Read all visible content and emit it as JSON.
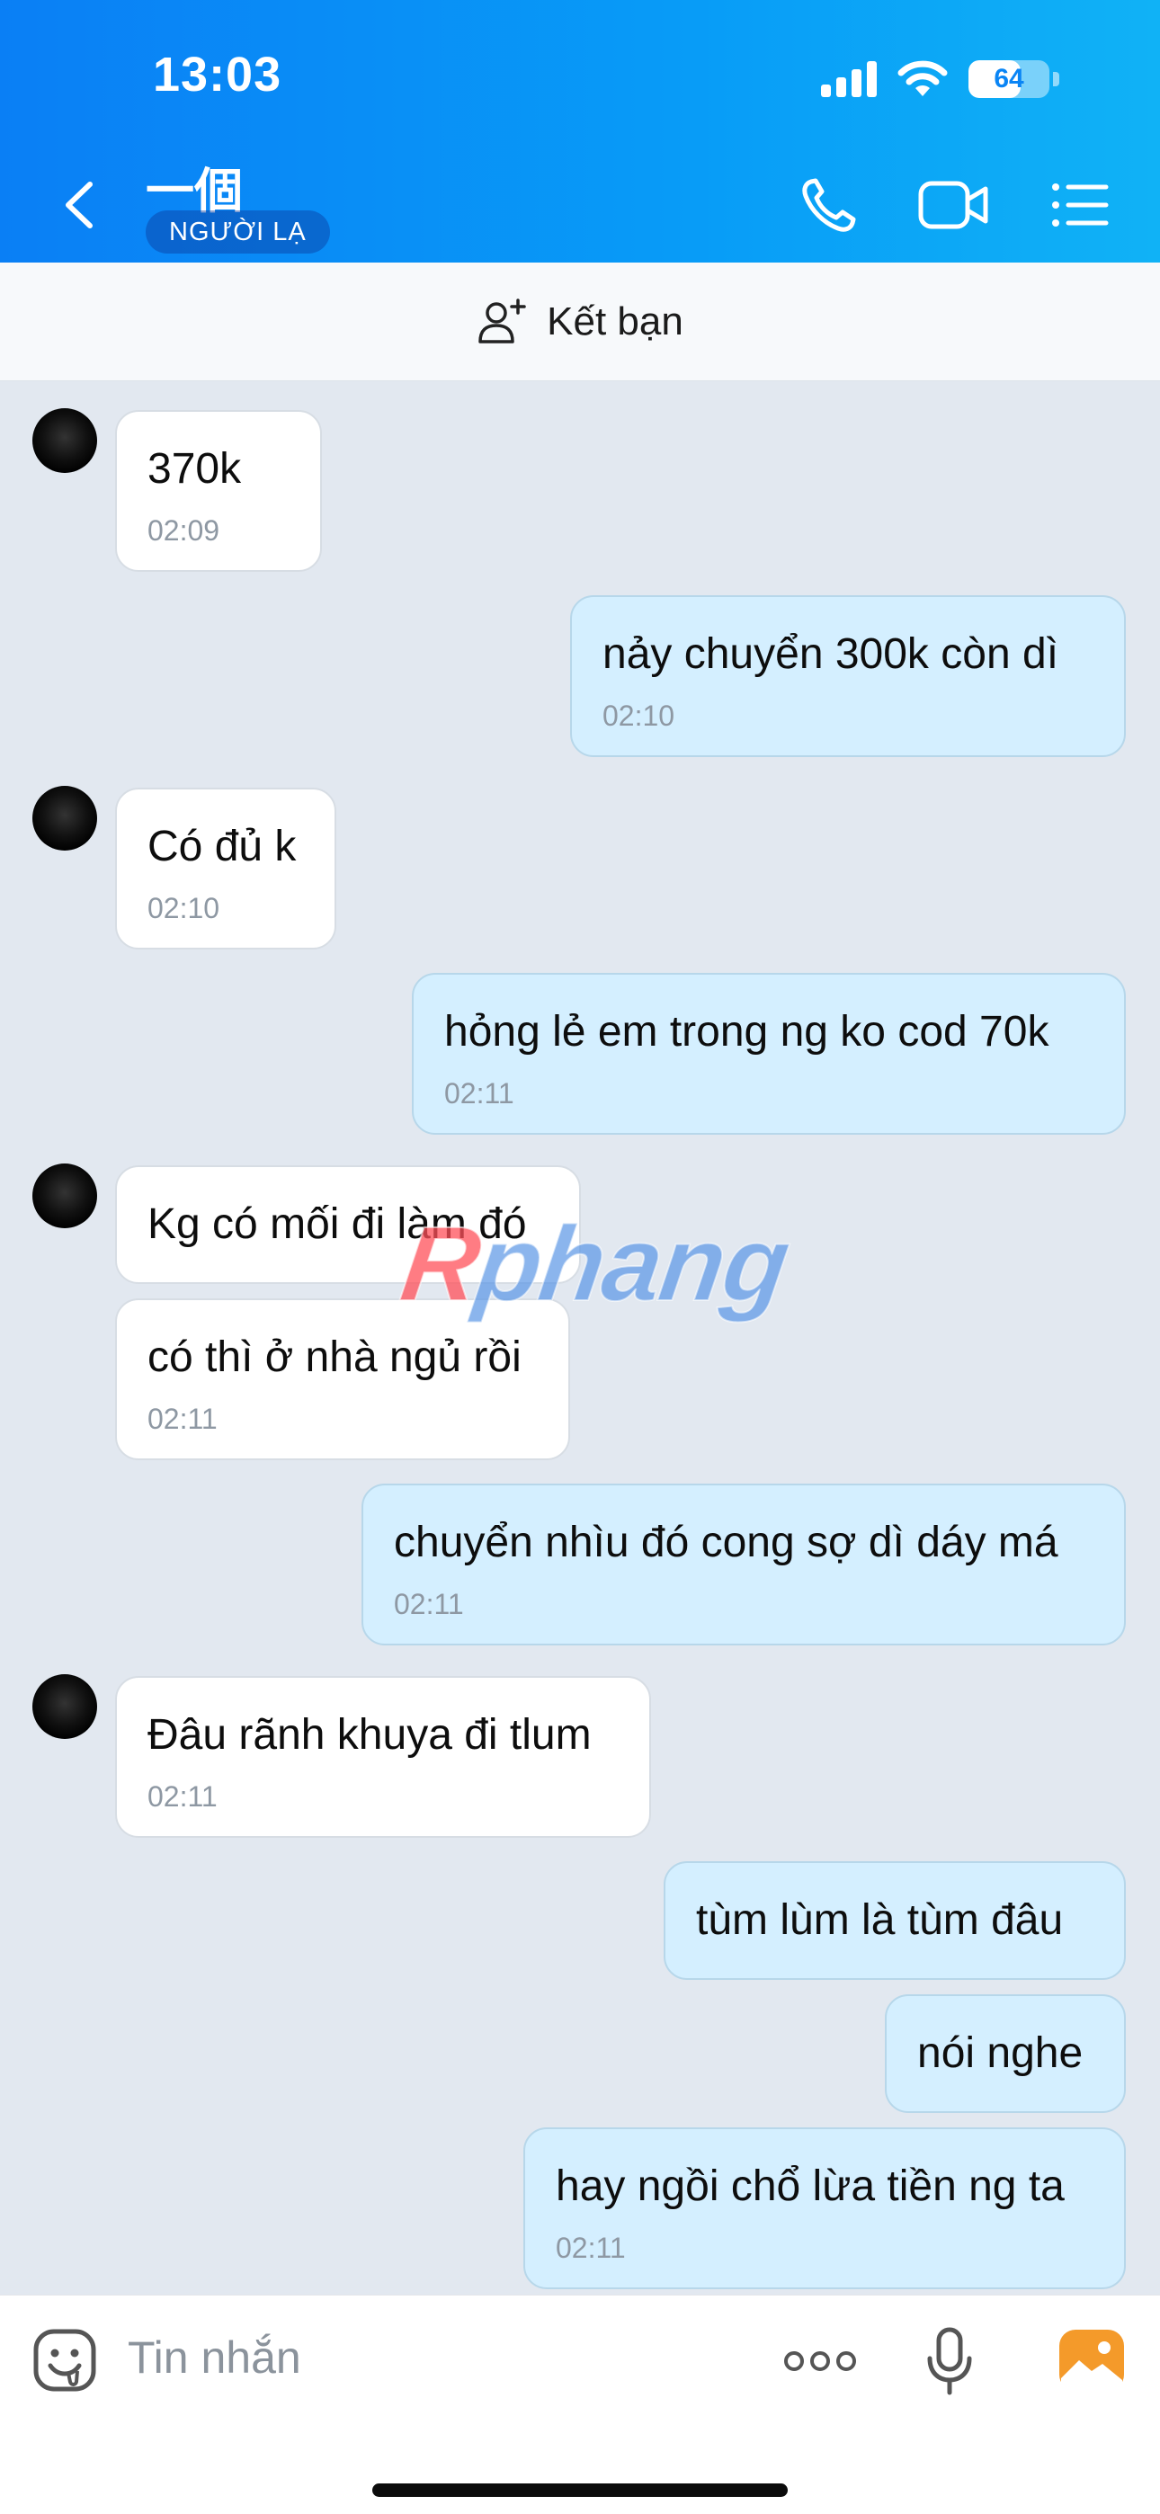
{
  "status_bar": {
    "time": "13:03",
    "battery": "64",
    "battery_level": 0.64
  },
  "header": {
    "contact_name": "一個",
    "badge": "NGƯỜI LẠ",
    "icons": [
      "back-chevron-icon",
      "phone-icon",
      "video-call-icon",
      "menu-list-icon"
    ]
  },
  "friend_bar": {
    "label": "Kết bạn",
    "icon": "add-friend-icon"
  },
  "messages": [
    {
      "dir": "in",
      "text": "370k",
      "time": "02:09"
    },
    {
      "dir": "out",
      "text": "nảy chuyển 300k còn dì",
      "time": "02:10"
    },
    {
      "dir": "in",
      "text": "Có đủ k",
      "time": "02:10"
    },
    {
      "dir": "out",
      "text": "hỏng lẻ em trong ng ko cod 70k",
      "time": "02:11"
    },
    {
      "dir": "in",
      "text": "Kg có mối đi làm đó",
      "time": ""
    },
    {
      "dir": "in",
      "text": "có thì ở nhà ngủ rồi",
      "time": "02:11"
    },
    {
      "dir": "out",
      "text": "chuyển nhìu đó cong sợ dì dáy má",
      "time": "02:11"
    },
    {
      "dir": "in",
      "text": "Đâu rãnh khuya đi tlum",
      "time": "02:11"
    },
    {
      "dir": "out",
      "text": "tùm lùm là tùm đâu",
      "time": ""
    },
    {
      "dir": "out",
      "text": "nói nghe",
      "time": ""
    },
    {
      "dir": "out",
      "text": "hay ngồi chổ lừa tiền ng ta",
      "time": "02:11"
    }
  ],
  "watermark": {
    "first": "R",
    "rest": "phang"
  },
  "input_bar": {
    "placeholder": "Tin nhắn",
    "icons": [
      "emoji-sticker-icon",
      "more-options-icon",
      "microphone-icon",
      "photo-gallery-icon"
    ]
  },
  "colors": {
    "header_start": "#0a7ff5",
    "header_end": "#10b2f6",
    "bubble_out": "#d4efff",
    "bubble_in": "#ffffff",
    "chat_bg": "#e2e8f0"
  }
}
